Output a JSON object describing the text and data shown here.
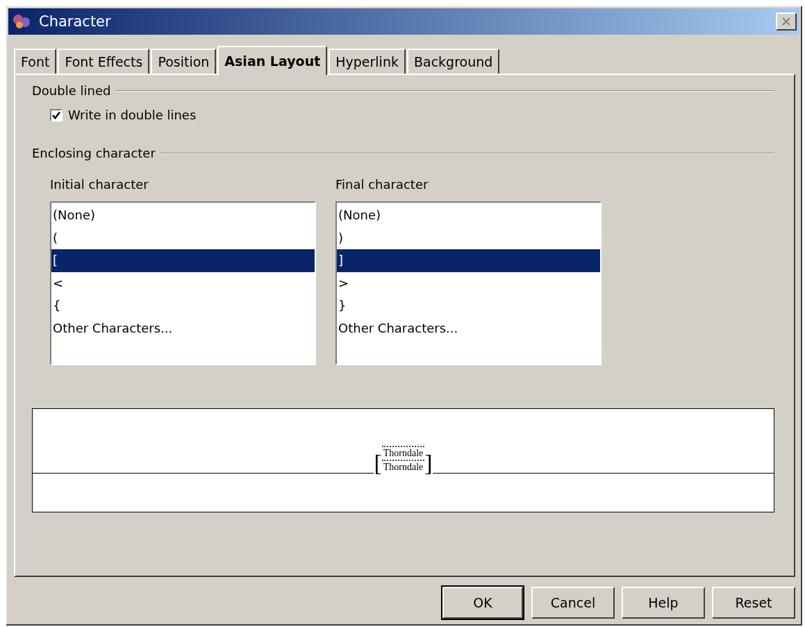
{
  "window": {
    "title": "Character"
  },
  "tabs": [
    {
      "label": "Font",
      "selected": false
    },
    {
      "label": "Font Effects",
      "selected": false
    },
    {
      "label": "Position",
      "selected": false
    },
    {
      "label": "Asian Layout",
      "selected": true
    },
    {
      "label": "Hyperlink",
      "selected": false
    },
    {
      "label": "Background",
      "selected": false
    }
  ],
  "double_lined": {
    "title": "Double lined",
    "checkbox": {
      "label": "Write in double lines",
      "checked": true
    }
  },
  "enclosing": {
    "title": "Enclosing character",
    "lists": [
      {
        "label": "Initial character",
        "items": [
          {
            "text": "(None)",
            "selected": false
          },
          {
            "text": "(",
            "selected": false
          },
          {
            "text": "[",
            "selected": true
          },
          {
            "text": "<",
            "selected": false
          },
          {
            "text": "{",
            "selected": false
          },
          {
            "text": "Other Characters...",
            "selected": false
          }
        ]
      },
      {
        "label": "Final character",
        "items": [
          {
            "text": "(None)",
            "selected": false
          },
          {
            "text": ")",
            "selected": false
          },
          {
            "text": "]",
            "selected": true
          },
          {
            "text": ">",
            "selected": false
          },
          {
            "text": "}",
            "selected": false
          },
          {
            "text": "Other Characters...",
            "selected": false
          }
        ]
      }
    ]
  },
  "preview": {
    "open": "[",
    "close": "]",
    "lines": [
      "Thorndale",
      "Thorndale"
    ]
  },
  "buttons": [
    {
      "label": "OK",
      "default": true
    },
    {
      "label": "Cancel",
      "default": false
    },
    {
      "label": "Help",
      "default": false
    },
    {
      "label": "Reset",
      "default": false
    }
  ]
}
